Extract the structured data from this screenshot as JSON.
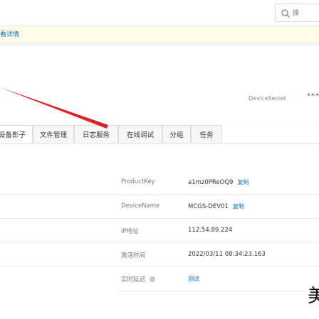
{
  "search": {
    "placeholder": "搜",
    "icon": "search-icon"
  },
  "notice": {
    "link_text": "看详情"
  },
  "device": {
    "secret_label": "DeviceSecret",
    "secret_value": "****"
  },
  "tabs": [
    {
      "label": "设备影子"
    },
    {
      "label": "文件管理"
    },
    {
      "label": "日志服务"
    },
    {
      "label": "在线调试"
    },
    {
      "label": "分组"
    },
    {
      "label": "任务"
    }
  ],
  "info": {
    "product_key": {
      "label": "ProductKey",
      "value": "a1mz0PReOQ9",
      "action": "复制"
    },
    "device_name": {
      "label": "DeviceName",
      "value": "MCGS-DEV01",
      "action": "复制"
    },
    "ip": {
      "label": "IP地址",
      "value": "112.54.89.224"
    },
    "activated": {
      "label": "激活时间",
      "value": "2022/03/11 08:34:23.163"
    },
    "latency": {
      "label": "实时延迟",
      "action": "测试"
    }
  },
  "corner_glyph": "美",
  "colors": {
    "link": "#0070cc",
    "annotation_arrow": "#e02020",
    "notice_bg": "#fffbe6"
  }
}
